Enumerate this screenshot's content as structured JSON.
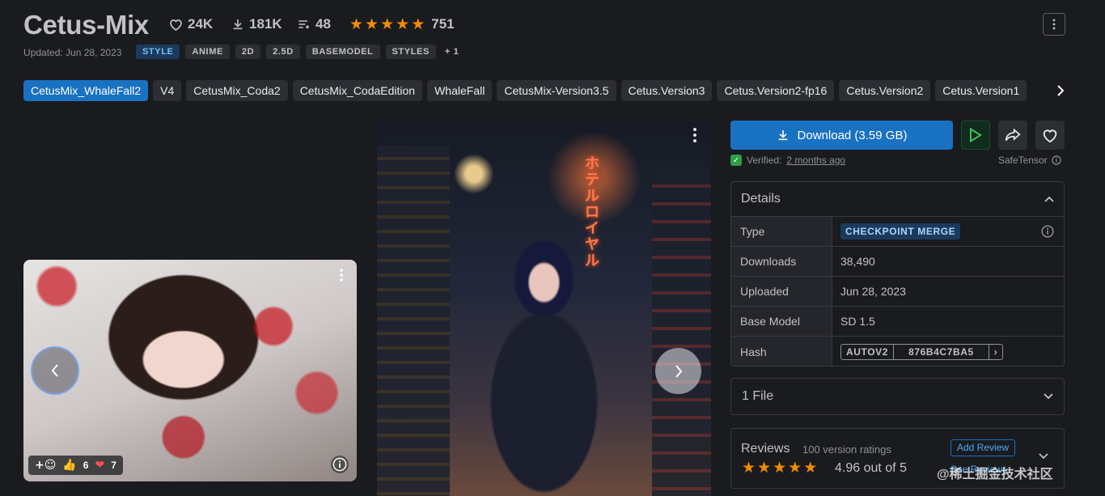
{
  "header": {
    "title": "Cetus-Mix",
    "likes": "24K",
    "downloads": "181K",
    "comments": "48",
    "rating_count": "751",
    "updated": "Updated: Jun 28, 2023",
    "tags": [
      "STYLE",
      "ANIME",
      "2D",
      "2.5D",
      "BASEMODEL",
      "STYLES",
      "+ 1"
    ]
  },
  "versions": [
    "CetusMix_WhaleFall2",
    "V4",
    "CetusMix_Coda2",
    "CetusMix_CodaEdition",
    "WhaleFall",
    "CetusMix-Version3.5",
    "Cetus.Version3",
    "Cetus.Version2-fp16",
    "Cetus.Version2",
    "Cetus.Version1"
  ],
  "gallery": {
    "reactions": {
      "thumbs": "6",
      "hearts": "7"
    },
    "neon_text": "ホテル\nロイヤ"
  },
  "actions": {
    "download_label": "Download (3.59 GB)",
    "verified_label": "Verified:",
    "verified_time": "2 months ago",
    "safetensor": "SafeTensor"
  },
  "details": {
    "title": "Details",
    "rows": {
      "type_k": "Type",
      "type_v": "CHECKPOINT MERGE",
      "downloads_k": "Downloads",
      "downloads_v": "38,490",
      "uploaded_k": "Uploaded",
      "uploaded_v": "Jun 28, 2023",
      "base_k": "Base Model",
      "base_v": "SD 1.5",
      "hash_k": "Hash",
      "hash_type": "AUTOV2",
      "hash_v": "876B4C7BA5"
    }
  },
  "files": {
    "label": "1 File"
  },
  "reviews": {
    "title": "Reviews",
    "subtitle": "100 version ratings",
    "score": "4.96 out of 5",
    "add_label": "Add Review",
    "see_label": "See Reviews"
  },
  "watermark": "@稀土掘金技术社区",
  "colors": {
    "accent": "#1971c2",
    "star": "#f08c00",
    "background": "#1a1b1e"
  }
}
